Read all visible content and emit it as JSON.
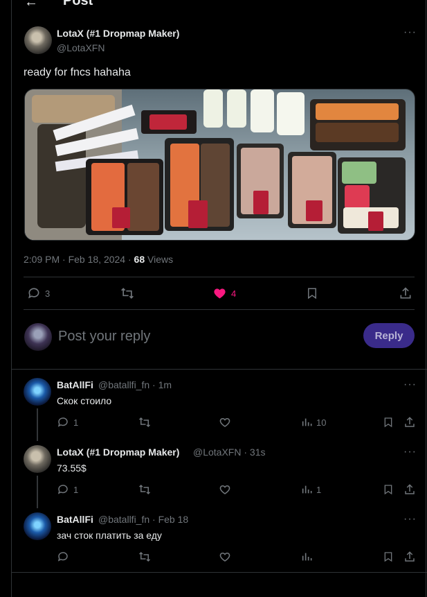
{
  "header": {
    "title": "Post",
    "back_icon": "arrow-left-icon"
  },
  "post": {
    "author_name": "LotaX (#1 Dropmap Maker)",
    "author_handle": "@LotaXFN",
    "text": "ready for fncs hahaha",
    "time": "2:09 PM · Feb 18, 2024 · ",
    "views_count": "68",
    "views_label": " Views",
    "replies": "3",
    "likes": "4",
    "liked": true
  },
  "compose": {
    "placeholder": "Post your reply",
    "button": "Reply"
  },
  "replies": [
    {
      "name": "BatAllFi",
      "handle": "@batallfi_fn · 1m",
      "text": "Скок стоило",
      "replies": "1",
      "views": "10"
    },
    {
      "name": "LotaX (#1 Dropmap Maker)",
      "handle": "@LotaXFN · 31s",
      "text": "73.55$",
      "replies": "1",
      "views": "1"
    },
    {
      "name": "BatAllFi",
      "handle": "@batallfi_fn · Feb 18",
      "text": "зач сток платить за еду",
      "replies": "",
      "views": ""
    }
  ],
  "colors": {
    "accent_like": "#f91880",
    "reply_button_bg": "#3a2b8a",
    "divider": "#2f3336",
    "muted": "#71767b"
  }
}
